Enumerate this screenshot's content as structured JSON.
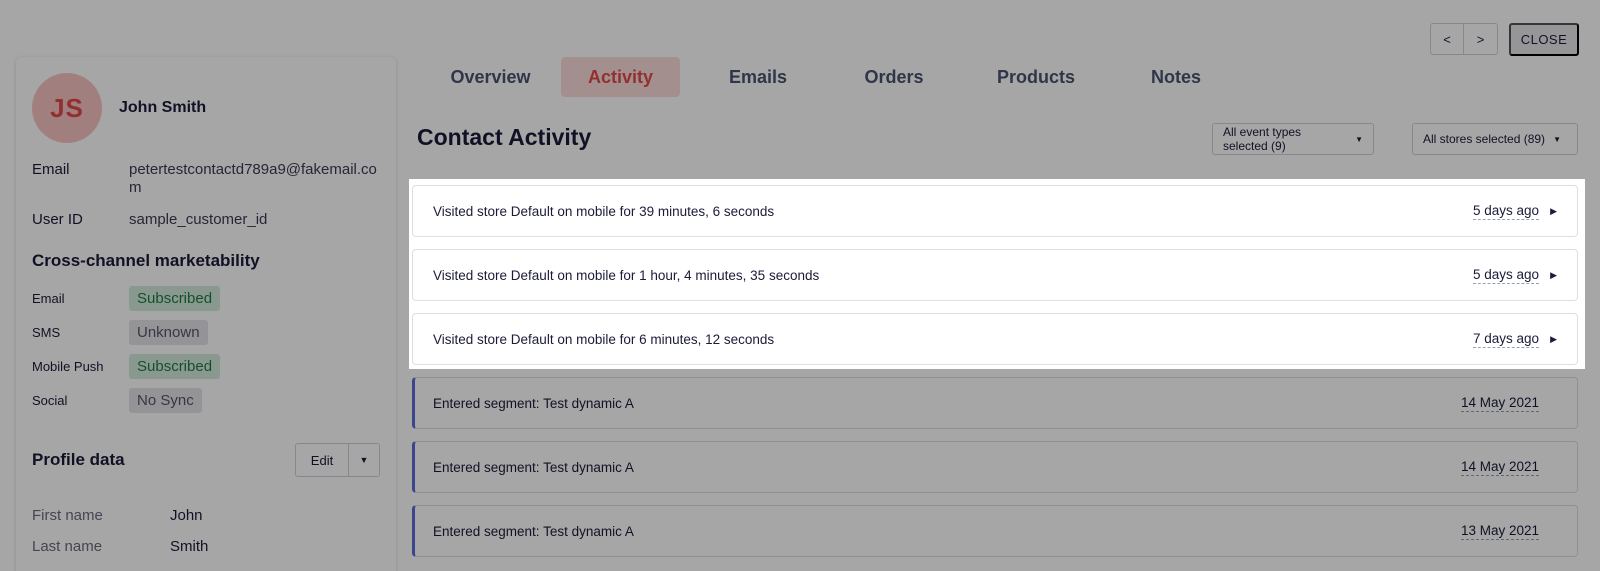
{
  "profile": {
    "initials": "JS",
    "name": "John Smith",
    "email_label": "Email",
    "email_value": "petertestcontactd789a9@fakemail.com",
    "userid_label": "User ID",
    "userid_value": "sample_customer_id"
  },
  "marketability": {
    "title": "Cross-channel marketability",
    "rows": [
      {
        "label": "Email",
        "status": "Subscribed"
      },
      {
        "label": "SMS",
        "status": "Unknown"
      },
      {
        "label": "Mobile Push",
        "status": "Subscribed"
      },
      {
        "label": "Social",
        "status": "No Sync"
      }
    ]
  },
  "profile_data": {
    "title": "Profile data",
    "edit_label": "Edit",
    "rows": [
      {
        "label": "First name",
        "value": "John"
      },
      {
        "label": "Last name",
        "value": "Smith"
      }
    ]
  },
  "tabs": [
    "Overview",
    "Activity",
    "Emails",
    "Orders",
    "Products",
    "Notes"
  ],
  "active_tab": "Activity",
  "nav": {
    "prev": "<",
    "next": ">",
    "close": "CLOSE"
  },
  "content": {
    "title": "Contact Activity",
    "filter_events": "All event types selected (9)",
    "filter_stores": "All stores selected (89)"
  },
  "activities": [
    {
      "text": "Visited store Default on mobile for 39 minutes, 6 seconds",
      "when": "5 days ago",
      "type": "visit"
    },
    {
      "text": "Visited store Default on mobile for 1 hour, 4 minutes, 35 seconds",
      "when": "5 days ago",
      "type": "visit"
    },
    {
      "text": "Visited store Default on mobile for 6 minutes, 12 seconds",
      "when": "7 days ago",
      "type": "visit"
    },
    {
      "text": "Entered segment: Test dynamic A",
      "when": "14 May 2021",
      "type": "segment"
    },
    {
      "text": "Entered segment: Test dynamic A",
      "when": "14 May 2021",
      "type": "segment"
    },
    {
      "text": "Entered segment: Test dynamic A",
      "when": "13 May 2021",
      "type": "segment"
    }
  ],
  "colors": {
    "accent": "#e04a4a",
    "subscribed_bg": "#d5ecde",
    "segment_border": "#5b6bd6"
  }
}
